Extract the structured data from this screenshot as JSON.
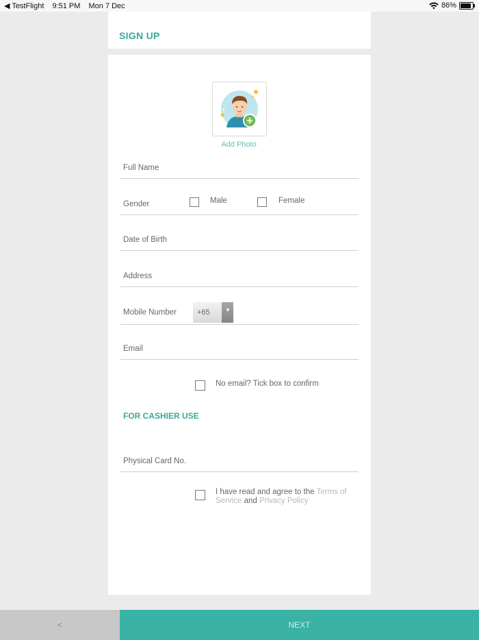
{
  "status_bar": {
    "back_app": "◀ TestFlight",
    "time": "9:51 PM",
    "date": "Mon 7 Dec",
    "battery_text": "86%",
    "battery_level": 0.86
  },
  "header": {
    "title": "SIGN UP"
  },
  "photo": {
    "add_photo_label": "Add Photo"
  },
  "form": {
    "full_name_label": "Full Name",
    "gender_label": "Gender",
    "gender_options": [
      "Male",
      "Female"
    ],
    "dob_label": "Date of Birth",
    "address_label": "Address",
    "mobile_label": "Mobile Number",
    "country_code": "+65",
    "email_label": "Email",
    "no_email_label": "No email? Tick box to confirm"
  },
  "cashier": {
    "section_title": "FOR CASHIER USE",
    "card_label": "Physical Card No."
  },
  "terms": {
    "prefix": "I have read and agree to the",
    "terms_link": "Terms of Service",
    "conjunction": "and",
    "privacy_link": "Privacy Policy"
  },
  "footer": {
    "back_label": "<",
    "next_label": "NEXT"
  },
  "colors": {
    "accent": "#3aa79a",
    "next_bg": "#3bb2a6",
    "back_bg": "#c8c8c8",
    "page_bg": "#ebebeb"
  }
}
